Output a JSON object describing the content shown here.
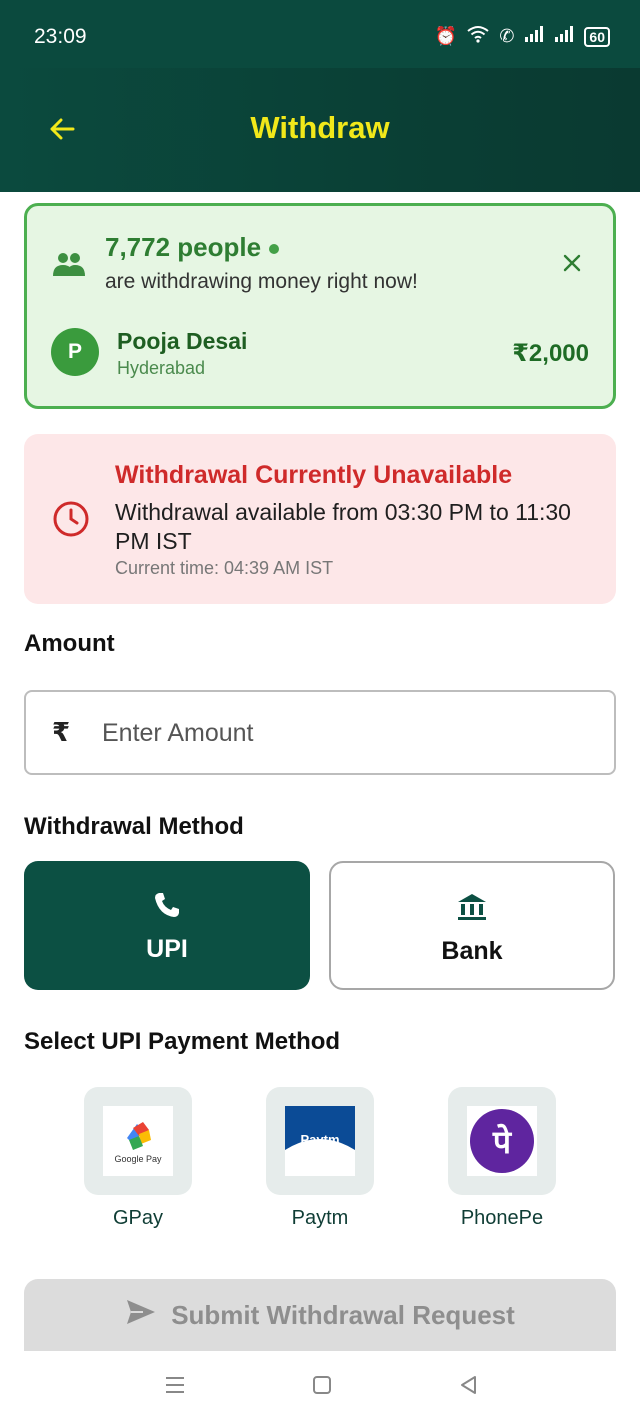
{
  "status_bar": {
    "time": "23:09",
    "battery": "60"
  },
  "app_bar": {
    "title": "Withdraw"
  },
  "live_card": {
    "count": "7,772 people",
    "subtitle": "are withdrawing money right now!",
    "avatar_initial": "P",
    "name": "Pooja Desai",
    "city": "Hyderabad",
    "amount": "₹2,000"
  },
  "alert": {
    "title": "Withdrawal Currently Unavailable",
    "message": "Withdrawal available from 03:30 PM to 11:30 PM IST",
    "current_time": "Current time: 04:39 AM IST"
  },
  "amount_section": {
    "label": "Amount",
    "currency_symbol": "₹",
    "placeholder": "Enter Amount",
    "value": ""
  },
  "method_section": {
    "label": "Withdrawal Method",
    "options": [
      {
        "label": "UPI",
        "selected": true
      },
      {
        "label": "Bank",
        "selected": false
      }
    ]
  },
  "upi_section": {
    "label": "Select UPI Payment Method",
    "apps": [
      {
        "label": "GPay",
        "logo_text": "Google Pay"
      },
      {
        "label": "Paytm",
        "logo_text": "Paytm"
      },
      {
        "label": "PhonePe",
        "logo_text": "पे"
      }
    ]
  },
  "submit": {
    "label": "Submit Withdrawal Request"
  },
  "colors": {
    "header": "#0b4a3e",
    "title": "#f2e81a",
    "accent_green": "#2e7d32",
    "alert_red": "#cf2a2a",
    "upi_selected": "#0c5043"
  }
}
